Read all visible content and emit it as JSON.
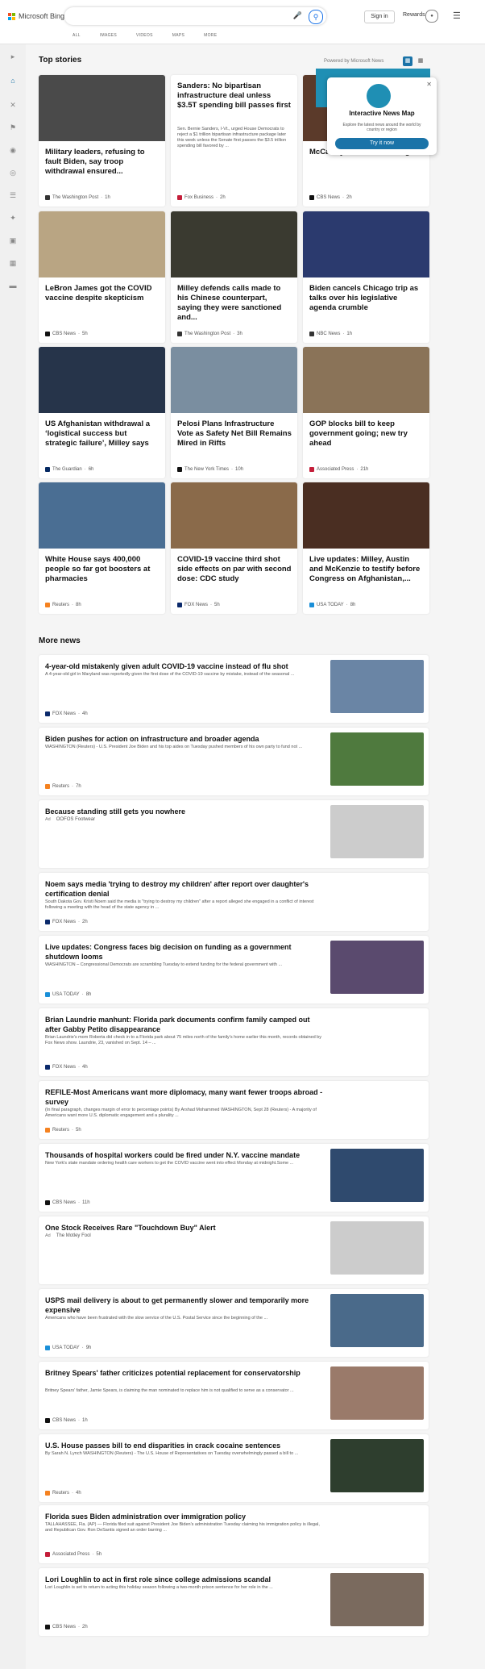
{
  "header": {
    "brand": "Microsoft Bing",
    "nav": [
      "ALL",
      "IMAGES",
      "VIDEOS",
      "MAPS",
      "MORE"
    ],
    "sign_in": "Sign in",
    "rewards": "Rewards"
  },
  "top_stories": {
    "title": "Top stories",
    "powered_by": "Powered by Microsoft News",
    "cards": [
      {
        "title": "Military leaders, refusing to fault Biden, say troop withdrawal ensured...",
        "source": "The Washington Post",
        "time": "1h",
        "img": "#4a4a4a",
        "ic": "#333"
      },
      {
        "title": "Sanders: No bipartisan infrastructure deal unless $3.5T spending bill passes first",
        "desc": "Sen. Bernie Sanders, I-Vt., urged House Democrats to reject a $1 trillion bipartisan infrastructure package later this week unless the Senate first passes the $3.5 trillion spending bill favored by ...",
        "source": "Fox Business",
        "time": "2h",
        "img": "",
        "ic": "#c41e3a"
      },
      {
        "title": "McCarthy ... latest ... ceiling",
        "source": "CBS News",
        "time": "2h",
        "img": "#5b3a2a",
        "ic": "#111"
      },
      {
        "title": "LeBron James got the COVID vaccine despite skepticism",
        "source": "CBS News",
        "time": "5h",
        "img": "#b9a583",
        "ic": "#111"
      },
      {
        "title": "Milley defends calls made to his Chinese counterpart, saying they were sanctioned and...",
        "source": "The Washington Post",
        "time": "3h",
        "img": "#3a3a30",
        "ic": "#333"
      },
      {
        "title": "Biden cancels Chicago trip as talks over his legislative agenda crumble",
        "source": "NBC News",
        "time": "1h",
        "img": "#2b3a6e",
        "ic": "#333"
      },
      {
        "title": "US Afghanistan withdrawal a ‘logistical success but strategic failure’, Milley says",
        "source": "The Guardian",
        "time": "6h",
        "img": "#26344a",
        "ic": "#052962"
      },
      {
        "title": "Pelosi Plans Infrastructure Vote as Safety Net Bill Remains Mired in Rifts",
        "source": "The New York Times",
        "time": "10h",
        "img": "#7a8ea0",
        "ic": "#111"
      },
      {
        "title": "GOP blocks bill to keep government going; new try ahead",
        "source": "Associated Press",
        "time": "21h",
        "img": "#8a7358",
        "ic": "#c41e3a"
      },
      {
        "title": "White House says 400,000 people so far got boosters at pharmacies",
        "source": "Reuters",
        "time": "8h",
        "img": "#4a6e93",
        "ic": "#f58220"
      },
      {
        "title": "COVID-19 vaccine third shot side effects on par with second dose: CDC study",
        "source": "FOX News",
        "time": "5h",
        "img": "#8a6a4a",
        "ic": "#0b2a6b"
      },
      {
        "title": "Live updates: Milley, Austin and McKenzie to testify before Congress on Afghanistan,...",
        "source": "USA TODAY",
        "time": "8h",
        "img": "#4a2e22",
        "ic": "#1a8fd8"
      }
    ],
    "popup": {
      "title": "Interactive News Map",
      "desc": "Explore the latest news around the world by country or region",
      "button": "Try it now"
    }
  },
  "more_news": {
    "title": "More news",
    "items": [
      {
        "title": "4-year-old mistakenly given adult COVID-19 vaccine instead of flu shot",
        "desc": "A 4-year-old girl in Maryland was reportedly given the first dose of the COVID-19 vaccine by mistake, instead of the seasonal ...",
        "source": "FOX News",
        "time": "4h",
        "ad": "",
        "thumb": "#6a85a5",
        "ic": "#0b2a6b"
      },
      {
        "title": "Biden pushes for action on infrastructure and broader agenda",
        "desc": "WASHINGTON (Reuters) - U.S. President Joe Biden and his top aides on Tuesday pushed members of his own party to fund not ...",
        "source": "Reuters",
        "time": "7h",
        "ad": "",
        "thumb": "#4f7a3e",
        "ic": "#f58220"
      },
      {
        "title": "Because standing still gets you nowhere",
        "desc": "",
        "source": "OOFOS Footwear",
        "time": "",
        "ad": "Ad",
        "thumb": "broken",
        "ic": ""
      },
      {
        "title": "Noem says media 'trying to destroy my children' after report over daughter's certification denial",
        "desc": "South Dakota Gov. Kristi Noem said the media is \"trying to destroy my children\" after a report alleged she engaged in a conflict of interest following a meeting with the head of the state agency in ...",
        "source": "FOX News",
        "time": "2h",
        "ad": "",
        "thumb": "",
        "ic": "#0b2a6b"
      },
      {
        "title": "Live updates: Congress faces big decision on funding as a government shutdown looms",
        "desc": "WASHINGTON – Congressional Democrats are scrambling Tuesday to extend funding for the federal government with ...",
        "source": "USA TODAY",
        "time": "8h",
        "ad": "",
        "thumb": "#5a4a6e",
        "ic": "#1a8fd8"
      },
      {
        "title": "Brian Laundrie manhunt: Florida park documents confirm family camped out after Gabby Petito disappearance",
        "desc": "Brian Laundrie's mom Roberta did check in to a Florida park about 75 miles north of the family's home earlier this month, records obtained by Fox News show. Laundrie, 23, vanished on Sept. 14 – ...",
        "source": "FOX News",
        "time": "4h",
        "ad": "",
        "thumb": "",
        "ic": "#0b2a6b"
      },
      {
        "title": "REFILE-Most Americans want more diplomacy, many want fewer troops abroad -survey",
        "desc": "(In final paragraph, changes margin of error to percentage points) By Arshad Mohammed WASHINGTON, Sept 28 (Reuters) - A majority of Americans want more U.S. diplomatic engagement and a plurality ...",
        "source": "Reuters",
        "time": "5h",
        "ad": "",
        "thumb": "",
        "ic": "#f58220"
      },
      {
        "title": "Thousands of hospital workers could be fired under N.Y. vaccine mandate",
        "desc": "New York's state mandate ordering health care workers to get the COVID vaccine went into effect Monday at midnight.Some ...",
        "source": "CBS News",
        "time": "11h",
        "ad": "",
        "thumb": "#2f4a6e",
        "ic": "#111"
      },
      {
        "title": "One Stock Receives Rare \"Touchdown Buy\" Alert",
        "desc": "",
        "source": "The Motley Fool",
        "time": "",
        "ad": "Ad",
        "thumb": "broken",
        "ic": ""
      },
      {
        "title": "USPS mail delivery is about to get permanently slower and temporarily more expensive",
        "desc": "Americans who have been frustrated with the slow service of the U.S. Postal Service since the beginning of the ...",
        "source": "USA TODAY",
        "time": "9h",
        "ad": "",
        "thumb": "#4a6a8a",
        "ic": "#1a8fd8"
      },
      {
        "title": "Britney Spears' father criticizes potential replacement for conservatorship",
        "desc": "Britney Spears' father, Jamie Spears, is claiming the man nominated to replace him is not qualified to serve as a conservator ...",
        "source": "CBS News",
        "time": "1h",
        "ad": "",
        "thumb": "#9a7a6a",
        "ic": "#111"
      },
      {
        "title": "U.S. House passes bill to end disparities in crack cocaine sentences",
        "desc": "By Sarah N. Lynch WASHINGTON (Reuters) - The U.S. House of Representatives on Tuesday overwhelmingly passed a bill to ...",
        "source": "Reuters",
        "time": "4h",
        "ad": "",
        "thumb": "#2e3e2e",
        "ic": "#f58220"
      },
      {
        "title": "Florida sues Biden administration over immigration policy",
        "desc": "TALLAHASSEE, Fla. (AP) — Florida filed suit against President Joe Biden's administration Tuesday claiming his immigration policy is illegal, and Republican Gov. Ron DeSantis signed an order barring ...",
        "source": "Associated Press",
        "time": "5h",
        "ad": "",
        "thumb": "",
        "ic": "#c41e3a"
      },
      {
        "title": "Lori Loughlin to act in first role since college admissions scandal",
        "desc": "Lori Loughlin is set to return to acting this holiday season following a two-month prison sentence for her role in the ...",
        "source": "CBS News",
        "time": "2h",
        "ad": "",
        "thumb": "#7a6a5e",
        "ic": "#111"
      }
    ]
  }
}
